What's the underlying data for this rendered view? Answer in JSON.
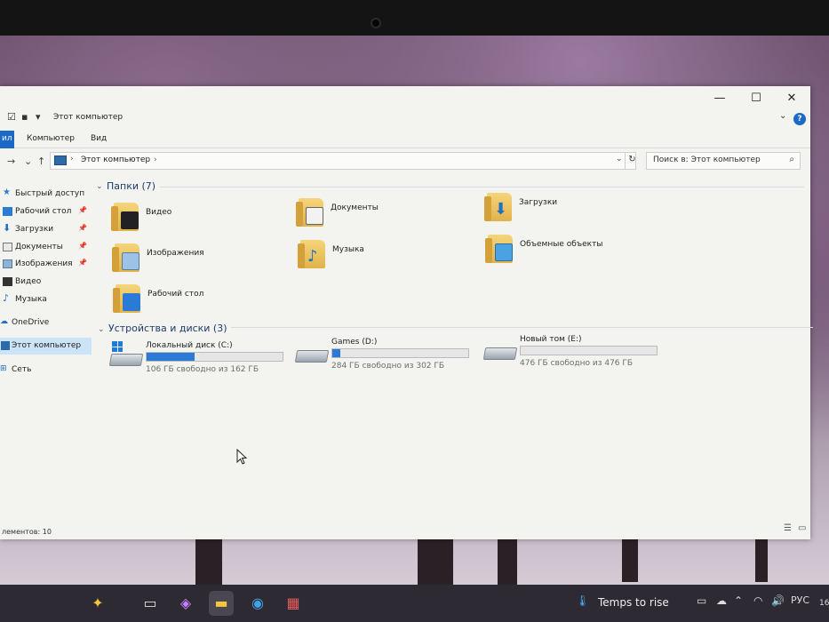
{
  "window": {
    "title": "Этот компьютер",
    "controls": {
      "minimize": "—",
      "maximize": "☐",
      "close": "✕"
    }
  },
  "ribbon": {
    "file_tab": "ил",
    "tabs": [
      "Компьютер",
      "Вид"
    ]
  },
  "address": {
    "path": "Этот компьютер",
    "search_placeholder": "Поиск в: Этот компьютер"
  },
  "sidebar": {
    "items": [
      {
        "label": "Быстрый доступ",
        "icon": "star-icon",
        "pinned": false,
        "selected": false
      },
      {
        "label": "Рабочий стол",
        "icon": "desktop-icon",
        "pinned": true,
        "selected": false
      },
      {
        "label": "Загрузки",
        "icon": "download-icon",
        "pinned": true,
        "selected": false
      },
      {
        "label": "Документы",
        "icon": "document-icon",
        "pinned": true,
        "selected": false
      },
      {
        "label": "Изображения",
        "icon": "image-icon",
        "pinned": true,
        "selected": false
      },
      {
        "label": "Видео",
        "icon": "video-icon",
        "pinned": false,
        "selected": false
      },
      {
        "label": "Музыка",
        "icon": "music-icon",
        "pinned": false,
        "selected": false
      },
      {
        "label": "OneDrive",
        "icon": "cloud-icon",
        "pinned": false,
        "selected": false
      },
      {
        "label": "Этот компьютер",
        "icon": "computer-icon",
        "pinned": false,
        "selected": true
      },
      {
        "label": "Сеть",
        "icon": "network-icon",
        "pinned": false,
        "selected": false
      }
    ]
  },
  "folders_section": {
    "title": "Папки (7)",
    "folders": [
      {
        "label": "Видео",
        "icon": "video-folder-icon"
      },
      {
        "label": "Документы",
        "icon": "documents-folder-icon"
      },
      {
        "label": "Загрузки",
        "icon": "downloads-folder-icon"
      },
      {
        "label": "Изображения",
        "icon": "pictures-folder-icon"
      },
      {
        "label": "Музыка",
        "icon": "music-folder-icon"
      },
      {
        "label": "Объемные объекты",
        "icon": "3d-objects-folder-icon"
      },
      {
        "label": "Рабочий стол",
        "icon": "desktop-folder-icon"
      }
    ]
  },
  "drives_section": {
    "title": "Устройства и диски (3)",
    "drives": [
      {
        "label": "Локальный диск (C:)",
        "free": "106 ГБ свободно из 162 ГБ",
        "used_fraction": 0.35
      },
      {
        "label": "Games (D:)",
        "free": "284 ГБ свободно из 302 ГБ",
        "used_fraction": 0.06
      },
      {
        "label": "Новый том (E:)",
        "free": "476 ГБ свободно из 476 ГБ",
        "used_fraction": 0.0
      }
    ]
  },
  "status_bar": {
    "text": "лементов: 10"
  },
  "taskbar": {
    "weather_text": "Temps to rise",
    "language": "РУС",
    "clock_partial": "16"
  },
  "colors": {
    "accent": "#1b6ac6",
    "drive_fill": "#2b7bd6",
    "selected_nav": "#cce4f7"
  }
}
